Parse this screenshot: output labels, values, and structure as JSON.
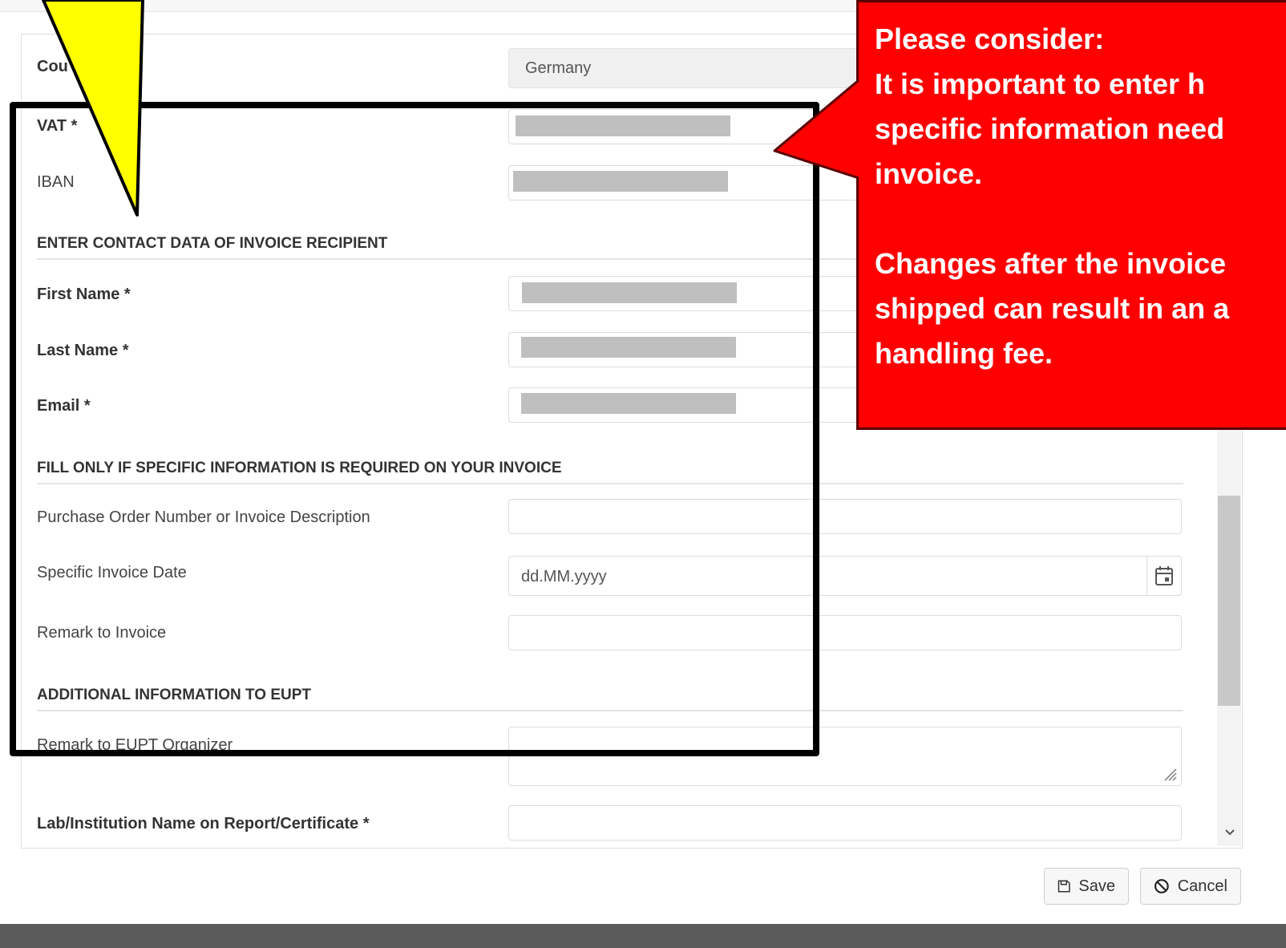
{
  "form": {
    "country_label": "Cou",
    "country_value": "Germany",
    "vat_label": "VAT *",
    "iban_label": "IBAN",
    "section_contact": "ENTER CONTACT DATA OF INVOICE RECIPIENT",
    "first_name_label": "First Name *",
    "last_name_label": "Last Name *",
    "email_label": "Email *",
    "section_specific": "FILL ONLY IF SPECIFIC INFORMATION IS REQUIRED ON YOUR INVOICE",
    "po_label": "Purchase Order Number or Invoice Description",
    "invoice_date_label": "Specific Invoice Date",
    "invoice_date_placeholder": "dd.MM.yyyy",
    "remark_invoice_label": "Remark to Invoice",
    "section_additional": "ADDITIONAL INFORMATION TO EUPT",
    "remark_organizer_label": "Remark to EUPT Organizer",
    "lab_name_label": "Lab/Institution Name on Report/Certificate *"
  },
  "buttons": {
    "save": "Save",
    "cancel": "Cancel"
  },
  "callout": {
    "text": "Please consider:\nIt is important to enter h\nspecific information need\ninvoice.\n\nChanges after the invoice\nshipped can result in an a\nhandling fee."
  },
  "colors": {
    "callout_bg": "#ff0000",
    "arrow_fill": "#ffff00"
  }
}
